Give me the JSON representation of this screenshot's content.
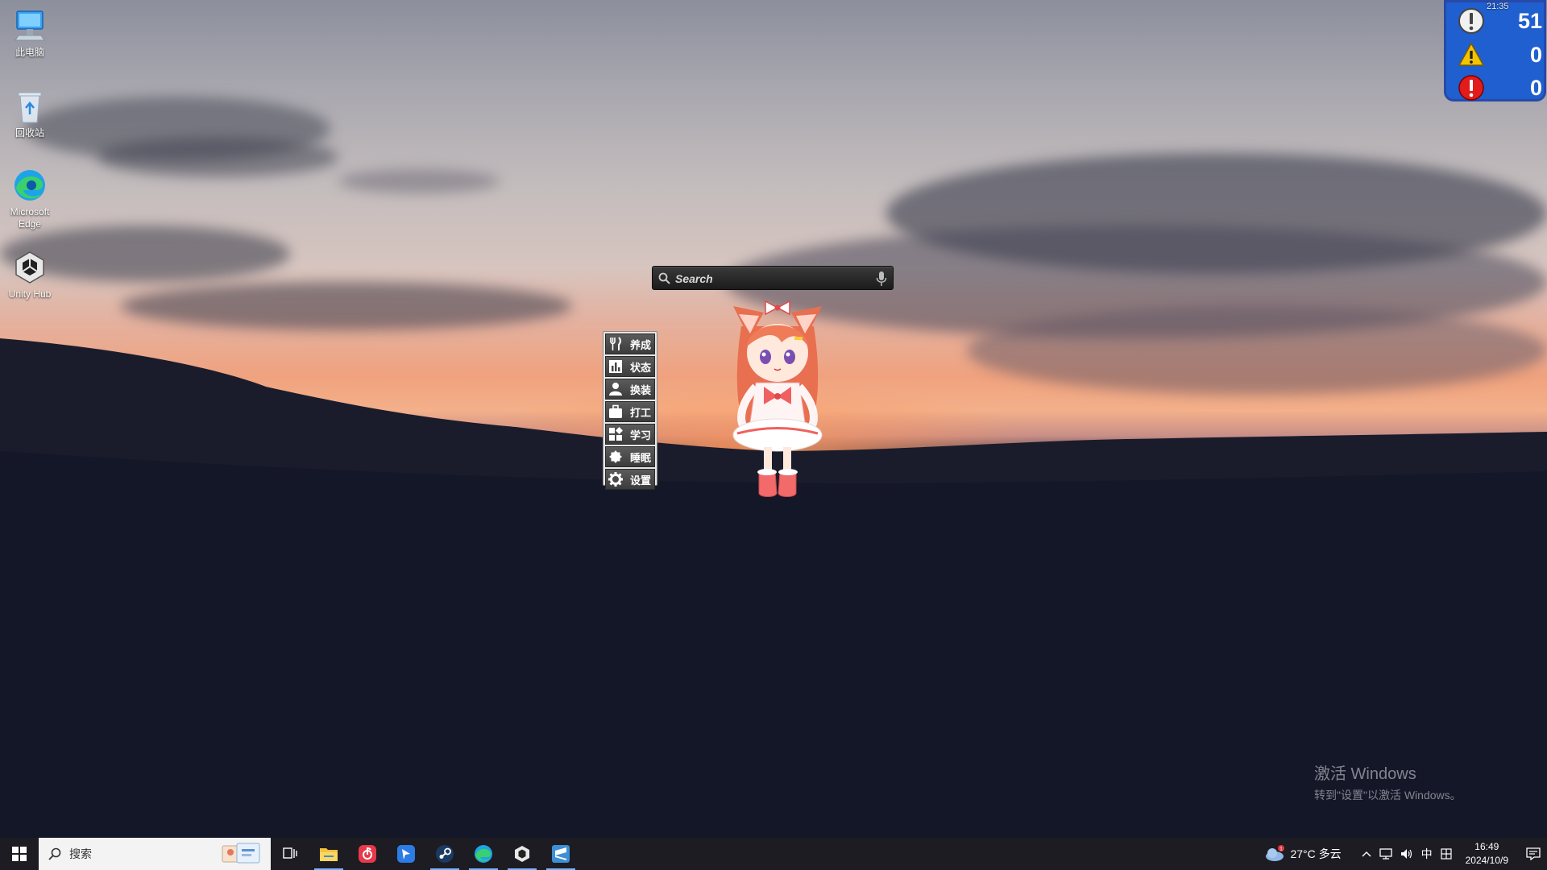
{
  "desktop": {
    "icons": [
      {
        "label": "此电脑",
        "icon": "computer-icon"
      },
      {
        "label": "回收站",
        "icon": "recycle-bin-icon"
      },
      {
        "label": "Microsoft Edge",
        "icon": "edge-icon"
      },
      {
        "label": "Unity Hub",
        "icon": "unity-hub-icon"
      }
    ]
  },
  "status_widget": {
    "time": "21:35",
    "info_count": "51",
    "warning_count": "0",
    "error_count": "0",
    "colors": {
      "background": "#1f5fcf",
      "warning": "#f5c400",
      "error": "#e21b1b"
    }
  },
  "search_bar": {
    "placeholder": "Search"
  },
  "side_menu": {
    "items": [
      {
        "label": "养成",
        "icon": "fork-knife-icon"
      },
      {
        "label": "状态",
        "icon": "bar-chart-icon"
      },
      {
        "label": "换装",
        "icon": "person-icon"
      },
      {
        "label": "打工",
        "icon": "briefcase-icon"
      },
      {
        "label": "学习",
        "icon": "blocks-icon"
      },
      {
        "label": "睡眠",
        "icon": "moon-icon"
      },
      {
        "label": "设置",
        "icon": "gear-icon"
      }
    ]
  },
  "watermark": {
    "title": "激活 Windows",
    "subtitle": "转到\"设置\"以激活 Windows。"
  },
  "taskbar": {
    "search_label": "搜索",
    "apps": [
      "file-explorer-icon",
      "netease-music-icon",
      "feishu-icon",
      "steam-icon",
      "edge-icon",
      "unity-hub-icon",
      "sublime-icon"
    ],
    "weather": "27°C 多云",
    "weather_badge": "1",
    "ime": "中",
    "time": "16:49",
    "date": "2024/10/9"
  }
}
